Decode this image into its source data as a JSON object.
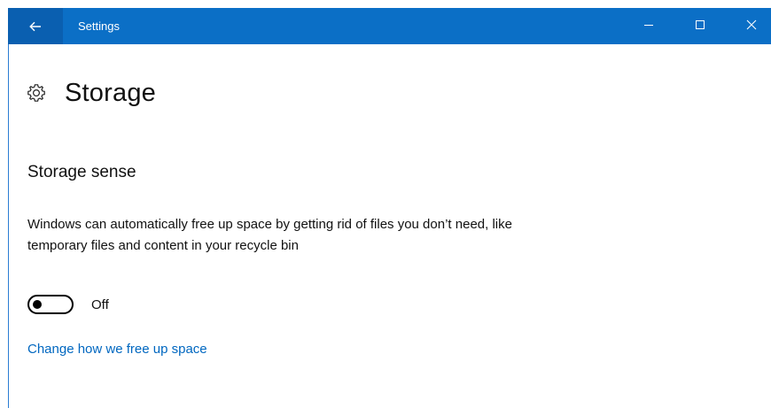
{
  "window": {
    "title": "Settings",
    "accent_color": "#0b6fc6",
    "controls": {
      "back_icon": "back-arrow-icon",
      "minimize_icon": "minimize-icon",
      "maximize_icon": "maximize-icon",
      "close_icon": "close-icon"
    }
  },
  "page": {
    "icon": "gear-icon",
    "title": "Storage"
  },
  "storage_sense": {
    "heading": "Storage sense",
    "description": "Windows can automatically free up space by getting rid of files you don’t need, like temporary files and content in your recycle bin",
    "toggle_state": "Off",
    "toggle_on": false,
    "link": "Change how we free up space",
    "link_color": "#0067c0"
  }
}
